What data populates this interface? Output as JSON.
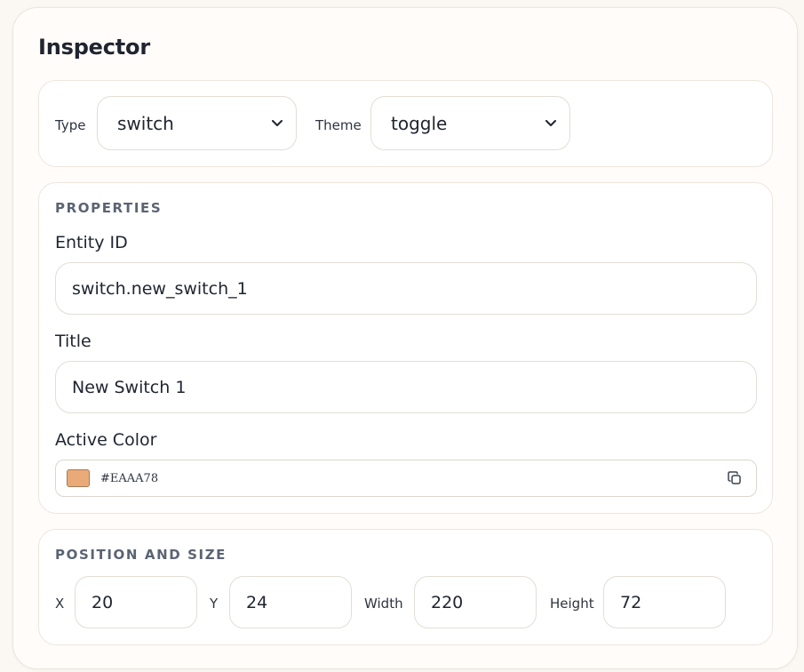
{
  "inspector": {
    "title": "Inspector"
  },
  "type_row": {
    "type_label": "Type",
    "type_value": "switch",
    "theme_label": "Theme",
    "theme_value": "toggle"
  },
  "properties": {
    "heading": "PROPERTIES",
    "entity_id_label": "Entity ID",
    "entity_id_value": "switch.new_switch_1",
    "title_label": "Title",
    "title_value": "New Switch 1",
    "active_color_label": "Active Color",
    "active_color_hex": "#EAAA78",
    "active_color_swatch": "#EAAA78",
    "copy_icon": "copy-icon"
  },
  "position": {
    "heading": "POSITION AND SIZE",
    "x_label": "X",
    "x_value": "20",
    "y_label": "Y",
    "y_value": "24",
    "width_label": "Width",
    "width_value": "220",
    "height_label": "Height",
    "height_value": "72"
  }
}
